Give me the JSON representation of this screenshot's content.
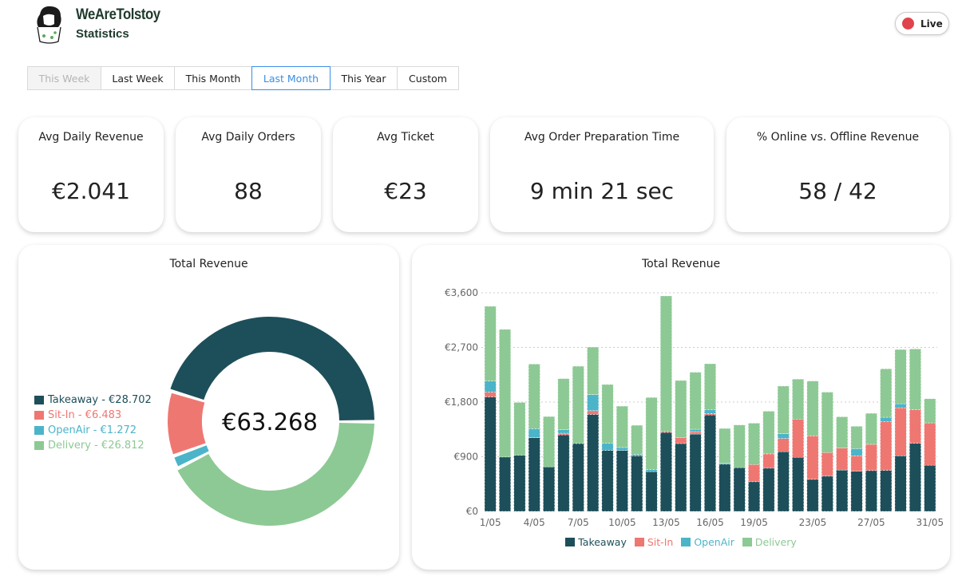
{
  "header": {
    "brand": "WeAreTolstoy",
    "subtitle": "Statistics",
    "live_label": "Live"
  },
  "date_ranges": [
    {
      "label": "This Week",
      "state": "disabled"
    },
    {
      "label": "Last Week",
      "state": "normal"
    },
    {
      "label": "This Month",
      "state": "normal"
    },
    {
      "label": "Last Month",
      "state": "active"
    },
    {
      "label": "This Year",
      "state": "normal"
    },
    {
      "label": "Custom",
      "state": "normal"
    }
  ],
  "kpis": [
    {
      "label": "Avg Daily Revenue",
      "value": "€2.041"
    },
    {
      "label": "Avg Daily Orders",
      "value": "88"
    },
    {
      "label": "Avg Ticket",
      "value": "€23"
    },
    {
      "label": "Avg Order Preparation Time",
      "value": "9 min 21 sec"
    },
    {
      "label": "% Online vs. Offline Revenue",
      "value": "58 / 42"
    }
  ],
  "colors": {
    "Takeaway": "#1d4f5a",
    "Sit-In": "#ef7772",
    "OpenAir": "#4cb4c9",
    "Delivery": "#8dc994"
  },
  "chart_data": [
    {
      "type": "pie",
      "title": "Total Revenue",
      "center_label": "€63.268",
      "legend": [
        "Takeaway - €28.702",
        "Sit-In - €6.483",
        "OpenAir - €1.272",
        "Delivery - €26.812"
      ],
      "slices": [
        {
          "name": "Takeaway",
          "value": 28702
        },
        {
          "name": "Delivery",
          "value": 26812
        },
        {
          "name": "OpenAir",
          "value": 1272
        },
        {
          "name": "Sit-In",
          "value": 6483
        }
      ]
    },
    {
      "type": "bar",
      "stacked": true,
      "title": "Total Revenue",
      "ylim": [
        0,
        3600
      ],
      "y_ticks": [
        "€0",
        "€900",
        "€1,800",
        "€2,700",
        "€3,600"
      ],
      "y_tick_values": [
        0,
        900,
        1800,
        2700,
        3600
      ],
      "grid": true,
      "legend_position": "bottom",
      "categories": [
        "1/05",
        "2/05",
        "3/05",
        "4/05",
        "5/05",
        "6/05",
        "7/05",
        "8/05",
        "9/05",
        "10/05",
        "11/05",
        "12/05",
        "13/05",
        "14/05",
        "15/05",
        "16/05",
        "17/05",
        "18/05",
        "19/05",
        "20/05",
        "21/05",
        "22/05",
        "23/05",
        "24/05",
        "25/05",
        "26/05",
        "27/05",
        "28/05",
        "29/05",
        "30/05",
        "31/05"
      ],
      "x_tick_labels": [
        "1/05",
        "4/05",
        "7/05",
        "10/05",
        "13/05",
        "16/05",
        "19/05",
        "23/05",
        "27/05",
        "31/05"
      ],
      "series": [
        {
          "name": "Takeaway",
          "values": [
            1885,
            895,
            925,
            1213,
            733,
            1261,
            1117,
            1597,
            1004,
            1004,
            916,
            655,
            1300,
            1117,
            1274,
            1588,
            777,
            720,
            489,
            711,
            982,
            890,
            528,
            580,
            681,
            663,
            672,
            676,
            916,
            1122,
            759
          ]
        },
        {
          "name": "Sit-In",
          "values": [
            79,
            0,
            0,
            0,
            0,
            26,
            0,
            61,
            0,
            0,
            0,
            0,
            22,
            101,
            39,
            22,
            0,
            0,
            283,
            236,
            218,
            629,
            716,
            389,
            362,
            253,
            432,
            799,
            790,
            554,
            699
          ]
        },
        {
          "name": "OpenAir",
          "values": [
            183,
            0,
            0,
            149,
            0,
            57,
            0,
            266,
            118,
            48,
            22,
            35,
            0,
            0,
            40,
            66,
            20,
            0,
            0,
            0,
            79,
            0,
            0,
            0,
            0,
            118,
            0,
            74,
            66,
            0,
            0
          ]
        },
        {
          "name": "Delivery",
          "values": [
            1231,
            2103,
            869,
            1064,
            829,
            842,
            1274,
            782,
            968,
            681,
            480,
            1186,
            2226,
            938,
            938,
            755,
            569,
            703,
            681,
            703,
            785,
            659,
            903,
            995,
            515,
            367,
            511,
            799,
            894,
            999,
            397
          ]
        }
      ]
    }
  ]
}
